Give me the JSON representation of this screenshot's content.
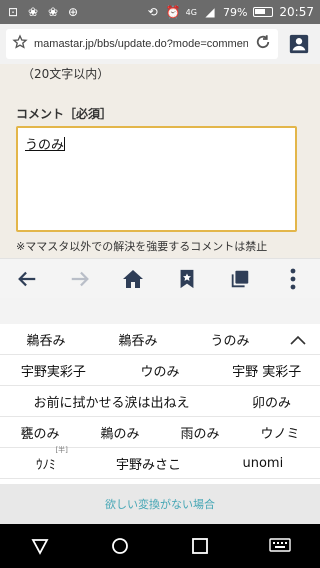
{
  "status_bar": {
    "network_label": "4G",
    "battery": "79%",
    "time": "20:57"
  },
  "browser": {
    "url": "mamastar.jp/bbs/update.do?mode=commen…"
  },
  "form": {
    "hint": "（20文字以内）",
    "comment_label": "コメント［必須］",
    "comment_value": "うのみ",
    "note": "※ママスタ以外での解決を強要するコメントは禁止"
  },
  "ime": {
    "rows": [
      [
        "鵜呑み",
        "鵜呑み",
        "うのみ"
      ],
      [
        "宇野実彩子",
        "ウのみ",
        "宇野 実彩子"
      ],
      [
        "お前に拭かせる涙は出ねえ",
        "卯のみ"
      ],
      [
        "甕のみ",
        "鵜のみ",
        "雨のみ",
        "ウノミ"
      ],
      [
        "ｳﾉﾐ",
        "宇野みさこ",
        "unomi"
      ]
    ],
    "halfwidth_tag": "[半]",
    "footer": "欲しい変換がない場合"
  },
  "icons": {
    "accent": "#e3b64a",
    "toolbar": [
      "back-arrow-icon",
      "forward-arrow-icon",
      "home-icon",
      "bookmark-icon",
      "tabs-icon",
      "more-vert-icon"
    ]
  }
}
